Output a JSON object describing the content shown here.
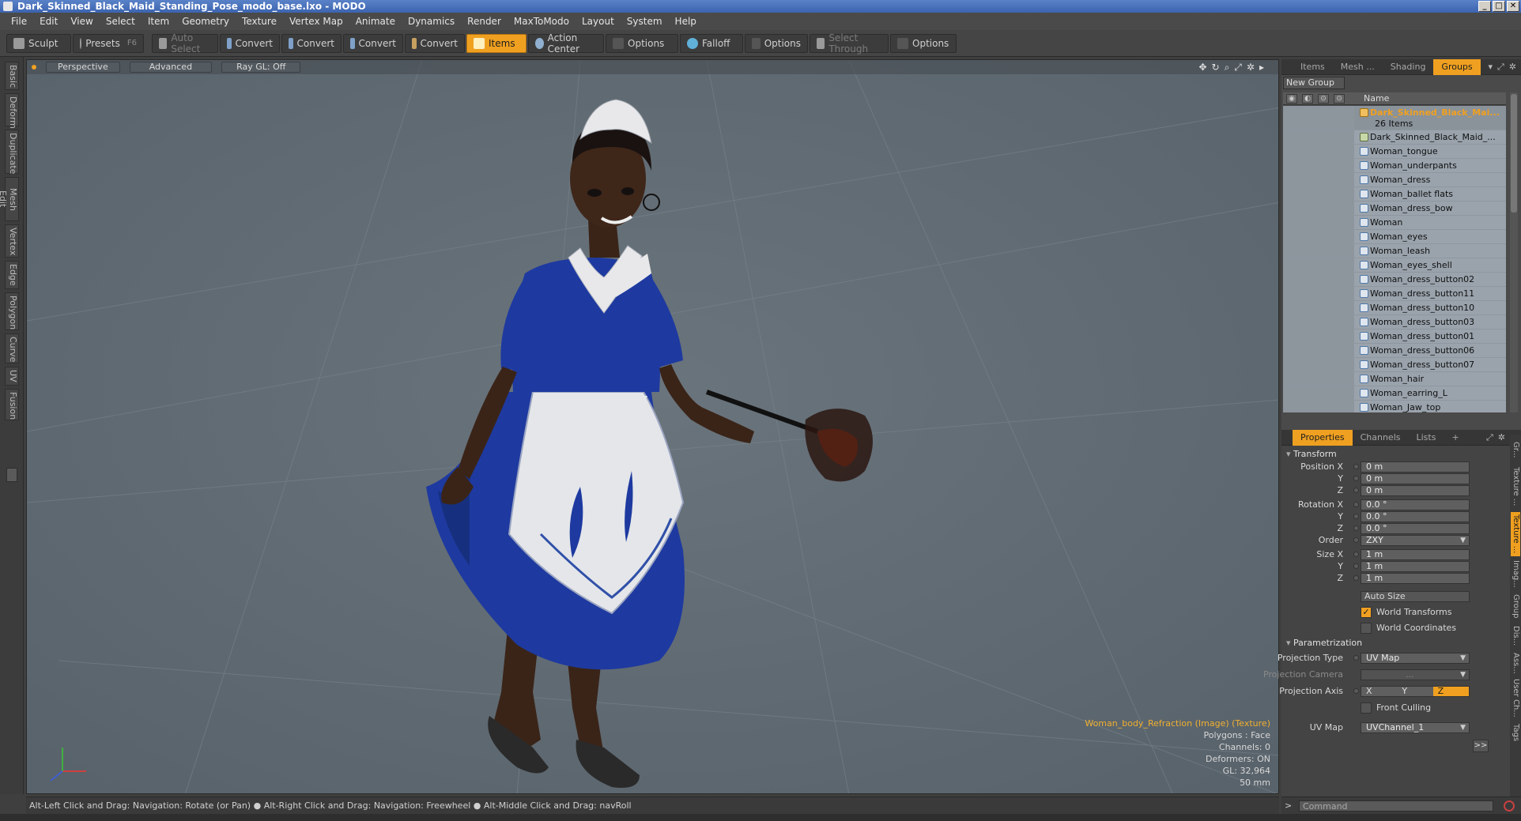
{
  "window": {
    "title": "Dark_Skinned_Black_Maid_Standing_Pose_modo_base.lxo - MODO",
    "controls": [
      "_",
      "□",
      "✕"
    ]
  },
  "menu": [
    "File",
    "Edit",
    "View",
    "Select",
    "Item",
    "Geometry",
    "Texture",
    "Vertex Map",
    "Animate",
    "Dynamics",
    "Render",
    "MaxToModo",
    "Layout",
    "System",
    "Help"
  ],
  "toolbar": {
    "sculpt": "Sculpt",
    "presets": "Presets",
    "presets_hotkey": "F6",
    "auto_select": "Auto Select",
    "convert1": "Convert",
    "convert2": "Convert",
    "convert3": "Convert",
    "convert4": "Convert",
    "items": "Items",
    "action_center": "Action Center",
    "options1": "Options",
    "falloff": "Falloff",
    "options2": "Options",
    "select_through": "Select Through",
    "options3": "Options"
  },
  "left_tabs": [
    "Basic",
    "Deform",
    "Duplicate",
    "Mesh Edit",
    "Vertex",
    "Edge",
    "Polygon",
    "Curve",
    "UV",
    "Fusion"
  ],
  "viewport": {
    "view_mode": "Perspective",
    "shading": "Advanced",
    "raygl": "Ray GL: Off",
    "info": {
      "texture": "Woman_body_Refraction (Image) (Texture)",
      "polygons": "Polygons : Face",
      "channels": "Channels: 0",
      "deformers": "Deformers: ON",
      "gl": "GL: 32,964",
      "distance": "50 mm"
    }
  },
  "status": "Alt-Left Click and Drag: Navigation: Rotate (or Pan) ● Alt-Right Click and Drag: Navigation: Freewheel ● Alt-Middle Click and Drag: navRoll",
  "right_tabs": {
    "items": "Items",
    "mesh": "Mesh ...",
    "shading": "Shading",
    "groups": "Groups"
  },
  "groups": {
    "new_group": "New Group",
    "name_header": "Name",
    "group_name": "Dark_Skinned_Black_Mai...",
    "group_count": "26 Items",
    "items": [
      "Dark_Skinned_Black_Maid_...",
      "Woman_tongue",
      "Woman_underpants",
      "Woman_dress",
      "Woman_ballet flats",
      "Woman_dress_bow",
      "Woman",
      "Woman_eyes",
      "Woman_leash",
      "Woman_eyes_shell",
      "Woman_dress_button02",
      "Woman_dress_button11",
      "Woman_dress_button10",
      "Woman_dress_button03",
      "Woman_dress_button01",
      "Woman_dress_button06",
      "Woman_dress_button07",
      "Woman_hair",
      "Woman_earring_L",
      "Woman_Jaw_top"
    ]
  },
  "props_tabs": {
    "properties": "Properties",
    "channels": "Channels",
    "lists": "Lists",
    "add": "+"
  },
  "properties": {
    "transform": "Transform",
    "position_label": "Position X",
    "pos_x": "0 m",
    "pos_y": "0 m",
    "pos_z": "0 m",
    "rotation_label": "Rotation X",
    "rot_x": "0.0 °",
    "rot_y": "0.0 °",
    "rot_z": "0.0 °",
    "order_label": "Order",
    "order": "ZXY",
    "size_label": "Size X",
    "size_x": "1 m",
    "size_y": "1 m",
    "size_z": "1 m",
    "y_label": "Y",
    "z_label": "Z",
    "auto_size": "Auto Size",
    "world_transforms": "World Transforms",
    "world_coordinates": "World Coordinates",
    "parametrization": "Parametrization",
    "projection_type_label": "Projection Type",
    "projection_type": "UV Map",
    "projection_camera_label": "Projection Camera",
    "projection_camera": "...",
    "projection_axis_label": "Projection Axis",
    "axis_x": "X",
    "axis_y": "Y",
    "axis_z": "Z",
    "front_culling": "Front Culling",
    "uv_map_label": "UV Map",
    "uv_map": "UVChannel_1",
    "more": ">>"
  },
  "props_vtabs": [
    "Gr...",
    "Texture ...",
    "Texture ...",
    "Imag...",
    "Group",
    "Dis...",
    "Ass...",
    "User Ch...",
    "Tags"
  ],
  "command": {
    "placeholder": "Command",
    "prompt": ">"
  }
}
